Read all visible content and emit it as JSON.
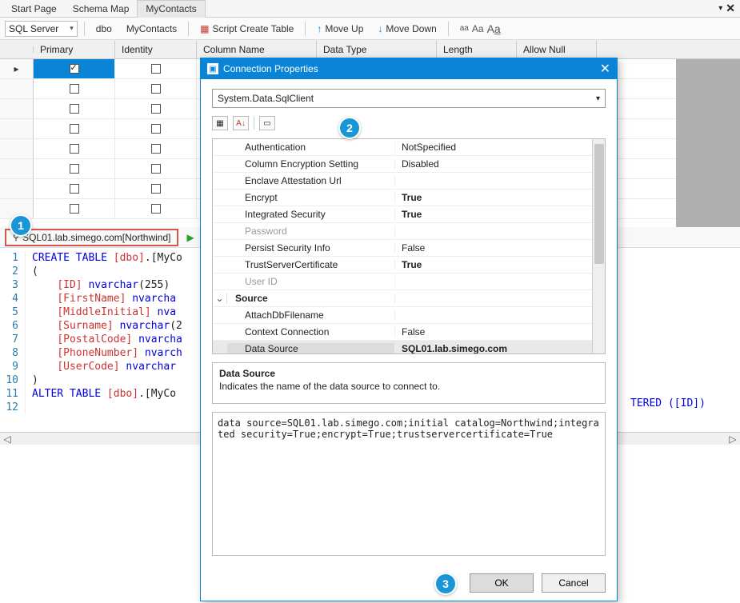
{
  "tabs": {
    "items": [
      "Start Page",
      "Schema Map",
      "MyContacts"
    ],
    "active_index": 2
  },
  "toolbar": {
    "provider": "SQL Server",
    "schema": "dbo",
    "table": "MyContacts",
    "script_create": "Script Create Table",
    "move_up": "Move Up",
    "move_down": "Move Down"
  },
  "grid": {
    "headers": [
      "Primary",
      "Identity",
      "Column Name",
      "Data Type",
      "Length",
      "Allow Null"
    ],
    "rows": [
      {
        "primary": true,
        "identity": false,
        "selected": true
      },
      {
        "primary": false,
        "identity": false
      },
      {
        "primary": false,
        "identity": false
      },
      {
        "primary": false,
        "identity": false
      },
      {
        "primary": false,
        "identity": false
      },
      {
        "primary": false,
        "identity": false
      },
      {
        "primary": false,
        "identity": false
      },
      {
        "primary": false,
        "identity": false
      }
    ]
  },
  "connection_label": "SQL01.lab.simego.com[Northwind]",
  "code": [
    {
      "n": 1,
      "t": "CREATE TABLE [dbo].[MyCo"
    },
    {
      "n": 2,
      "t": "("
    },
    {
      "n": 3,
      "t": "    [ID] nvarchar(255) "
    },
    {
      "n": 4,
      "t": "    [FirstName] nvarcha"
    },
    {
      "n": 5,
      "t": "    [MiddleInitial] nva"
    },
    {
      "n": 6,
      "t": "    [Surname] nvarchar(2"
    },
    {
      "n": 7,
      "t": "    [PostalCode] nvarcha"
    },
    {
      "n": 8,
      "t": "    [PhoneNumber] nvarch"
    },
    {
      "n": 9,
      "t": "    [UserCode] nvarchar"
    },
    {
      "n": 10,
      "t": ")"
    },
    {
      "n": 11,
      "t": "ALTER TABLE [dbo].[MyCo"
    },
    {
      "n": 12,
      "t": ""
    }
  ],
  "code_tail": "TERED ([ID])",
  "dialog": {
    "title": "Connection Properties",
    "provider": "System.Data.SqlClient",
    "properties": [
      {
        "name": "Authentication",
        "value": "NotSpecified"
      },
      {
        "name": "Column Encryption Setting",
        "value": "Disabled"
      },
      {
        "name": "Enclave Attestation Url",
        "value": ""
      },
      {
        "name": "Encrypt",
        "value": "True",
        "bold": true
      },
      {
        "name": "Integrated Security",
        "value": "True",
        "bold": true
      },
      {
        "name": "Password",
        "value": "",
        "disabled": true
      },
      {
        "name": "Persist Security Info",
        "value": "False"
      },
      {
        "name": "TrustServerCertificate",
        "value": "True",
        "bold": true
      },
      {
        "name": "User ID",
        "value": "",
        "disabled": true
      }
    ],
    "category": "Source",
    "source_props": [
      {
        "name": "AttachDbFilename",
        "value": ""
      },
      {
        "name": "Context Connection",
        "value": "False"
      },
      {
        "name": "Data Source",
        "value": "SQL01.lab.simego.com",
        "bold": true,
        "selected": true
      }
    ],
    "help": {
      "title": "Data Source",
      "desc": "Indicates the name of the data source to connect to."
    },
    "conn_string": "data source=SQL01.lab.simego.com;initial catalog=Northwind;integrated security=True;encrypt=True;trustservercertificate=True",
    "ok": "OK",
    "cancel": "Cancel"
  },
  "badges": {
    "b1": "1",
    "b2": "2",
    "b3": "3"
  }
}
